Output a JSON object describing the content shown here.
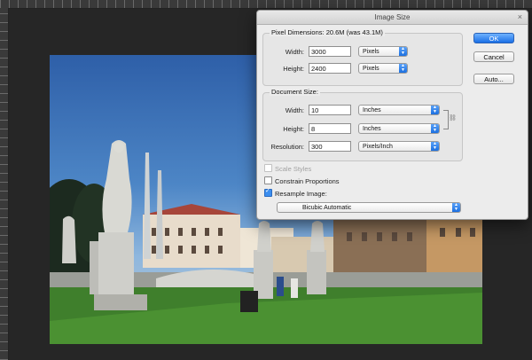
{
  "dialog": {
    "title": "Image Size",
    "pixel_dimensions_label": "Pixel Dimensions:",
    "pixel_dimensions_value": "20.6M (was 43.1M)",
    "width_label": "Width:",
    "width_value": "3000",
    "width_unit": "Pixels",
    "height_label": "Height:",
    "height_value": "2400",
    "height_unit": "Pixels",
    "document_size_label": "Document Size:",
    "doc_width_label": "Width:",
    "doc_width_value": "10",
    "doc_width_unit": "Inches",
    "doc_height_label": "Height:",
    "doc_height_value": "8",
    "doc_height_unit": "Inches",
    "resolution_label": "Resolution:",
    "resolution_value": "300",
    "resolution_unit": "Pixels/Inch",
    "scale_styles_label": "Scale Styles",
    "constrain_label": "Constrain Proportions",
    "resample_label": "Resample Image:",
    "resample_method": "Bicubic Automatic",
    "ok_label": "OK",
    "cancel_label": "Cancel",
    "auto_label": "Auto..."
  },
  "checkboxes": {
    "scale_styles": false,
    "constrain_proportions": false,
    "resample_image": true
  },
  "colors": {
    "primary_button": "#1a6fe5",
    "workspace": "#2b2b2b"
  },
  "icons": [
    "link-icon",
    "dropdown-arrow-icon",
    "checkmark-icon"
  ]
}
